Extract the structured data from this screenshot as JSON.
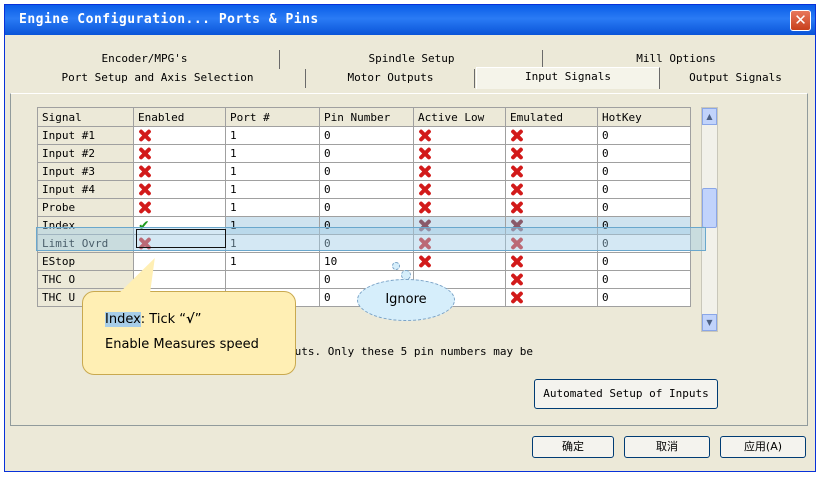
{
  "window": {
    "title": "Engine Configuration... Ports & Pins",
    "close_symbol": "✕"
  },
  "tabs_row1": [
    "Encoder/MPG's",
    "Spindle Setup",
    "Mill Options"
  ],
  "tabs_row2": [
    "Port Setup and Axis Selection",
    "Motor Outputs",
    "Input Signals",
    "Output Signals"
  ],
  "active_tab": "Input Signals",
  "columns": [
    "Signal",
    "Enabled",
    "Port #",
    "Pin Number",
    "Active Low",
    "Emulated",
    "HotKey"
  ],
  "rows": [
    {
      "signal": "Input #1",
      "enabled": "x",
      "port": "1",
      "pin": "0",
      "active_low": "x",
      "emulated": "x",
      "hotkey": "0"
    },
    {
      "signal": "Input #2",
      "enabled": "x",
      "port": "1",
      "pin": "0",
      "active_low": "x",
      "emulated": "x",
      "hotkey": "0"
    },
    {
      "signal": "Input #3",
      "enabled": "x",
      "port": "1",
      "pin": "0",
      "active_low": "x",
      "emulated": "x",
      "hotkey": "0"
    },
    {
      "signal": "Input #4",
      "enabled": "x",
      "port": "1",
      "pin": "0",
      "active_low": "x",
      "emulated": "x",
      "hotkey": "0"
    },
    {
      "signal": "Probe",
      "enabled": "x",
      "port": "1",
      "pin": "0",
      "active_low": "x",
      "emulated": "x",
      "hotkey": "0"
    },
    {
      "signal": "Index",
      "enabled": "check",
      "port": "1",
      "pin": "0",
      "active_low": "x",
      "emulated": "x",
      "hotkey": "0"
    },
    {
      "signal": "Limit Ovrd",
      "enabled": "x",
      "port": "1",
      "pin": "0",
      "active_low": "x",
      "emulated": "x",
      "hotkey": "0"
    },
    {
      "signal": "EStop",
      "enabled": "",
      "port": "1",
      "pin": "10",
      "active_low": "x",
      "emulated": "x",
      "hotkey": "0"
    },
    {
      "signal": "THC O",
      "enabled": "",
      "port": "",
      "pin": "0",
      "active_low": "",
      "emulated": "x",
      "hotkey": "0"
    },
    {
      "signal": "THC U",
      "enabled": "",
      "port": "",
      "pin": "0",
      "active_low": "x",
      "emulated": "x",
      "hotkey": "0"
    }
  ],
  "selected_row": 5,
  "note": "puts. Only these 5 pin numbers may be",
  "buttons": {
    "automated": "Automated Setup of Inputs",
    "ok": "确定",
    "cancel": "取消",
    "apply": "应用(A)"
  },
  "callout": {
    "word": "Index",
    "rest": ": Tick “",
    "tick": "√",
    "end": "”",
    "line2": "Enable Measures speed"
  },
  "ignore": "Ignore",
  "colors": {
    "title_bar": "#0a5de8",
    "x_mark": "#d21a1a",
    "check_mark": "#1e9a1e",
    "callout_fill": "#ffefb4",
    "ignore_fill": "#d6eefb"
  }
}
